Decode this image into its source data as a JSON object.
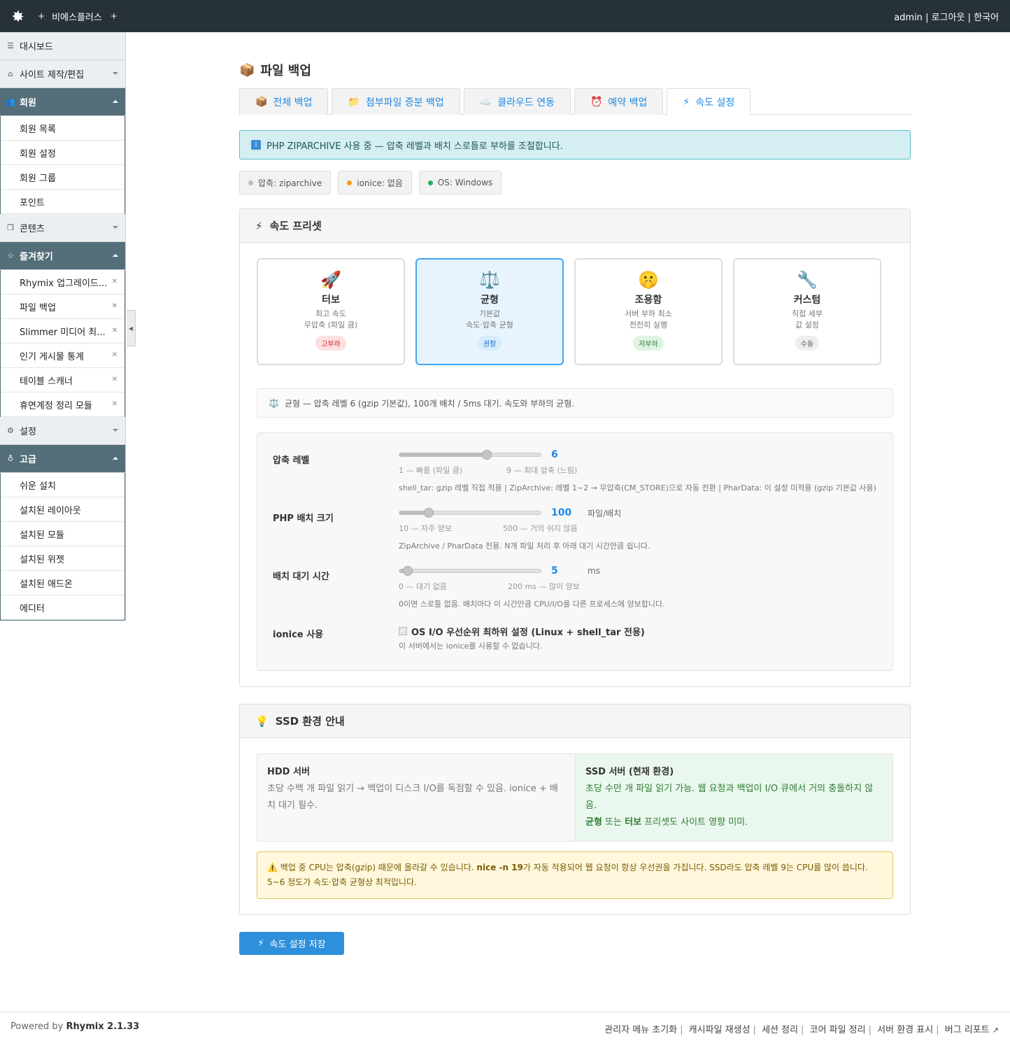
{
  "topbar": {
    "brand": "비에스플러스",
    "plus": "+",
    "user": "admin",
    "sep": "|",
    "logout": "로그아웃",
    "lang": "한국어"
  },
  "sidebar": {
    "dashboard": "대시보드",
    "site_edit": "사이트 제작/편집",
    "member": {
      "label": "회원",
      "items": [
        "회원 목록",
        "회원 설정",
        "회원 그룹",
        "포인트"
      ]
    },
    "content": "콘텐츠",
    "favorites": {
      "label": "즐겨찾기",
      "items": [
        "Rhymix 업그레이드...",
        "파일 백업",
        "Slimmer 미디어 최...",
        "인기 게시물 통계",
        "테이블 스캐너",
        "휴면계정 정리 모듈"
      ]
    },
    "settings": "설정",
    "advanced": {
      "label": "고급",
      "items": [
        "쉬운 설치",
        "설치된 레이아웃",
        "설치된 모듈",
        "설치된 위젯",
        "설치된 애드온",
        "에디터"
      ]
    }
  },
  "page": {
    "title": "파일 백업",
    "title_icon": "📦"
  },
  "tabs": [
    {
      "icon": "📦",
      "label": "전체 백업"
    },
    {
      "icon": "📁",
      "label": "첨부파일 증분 백업"
    },
    {
      "icon": "☁️",
      "label": "클라우드 연동"
    },
    {
      "icon": "⏰",
      "label": "예약 백업"
    },
    {
      "icon": "⚡",
      "label": "속도 설정"
    }
  ],
  "info": {
    "icon": "i",
    "text": "PHP ZIPARCHIVE 사용 중 — 압축 레벨과 배치 스로틀로 부하를 조절합니다."
  },
  "chips": [
    {
      "label": "압축: ziparchive",
      "color": "#bdbdbd"
    },
    {
      "label": "ionice: 없음",
      "color": "#f39c12"
    },
    {
      "label": "OS: Windows",
      "color": "#27ae60"
    }
  ],
  "preset_panel": {
    "title": "속도 프리셋",
    "icon": "⚡",
    "presets": [
      {
        "emoji": "🚀",
        "name": "터보",
        "desc1": "최고 속도",
        "desc2": "무압축 (파일 큼)",
        "badge": "고부하",
        "badge_bg": "#fde0e0",
        "badge_fg": "#c62828"
      },
      {
        "emoji": "⚖️",
        "name": "균형",
        "desc1": "기본값",
        "desc2": "속도·압축 균형",
        "badge": "권장",
        "badge_bg": "#d6ebfb",
        "badge_fg": "#1565c0"
      },
      {
        "emoji": "🤫",
        "name": "조용함",
        "desc1": "서버 부하 최소",
        "desc2": "천천히 실행",
        "badge": "저부하",
        "badge_bg": "#dff3e3",
        "badge_fg": "#2e7d32"
      },
      {
        "emoji": "🔧",
        "name": "커스텀",
        "desc1": "직접 세부",
        "desc2": "값 설정",
        "badge": "수동",
        "badge_bg": "#eeeeee",
        "badge_fg": "#555555"
      }
    ],
    "desc_icon": "⚖️",
    "desc": "균형 — 압축 레벨 6 (gzip 기본값), 100개 배치 / 5ms 대기. 속도와 부하의 균형.",
    "compression": {
      "label": "압축 레벨",
      "value": "6",
      "min": 1,
      "max": 9,
      "num": 6,
      "tick_min": "1 — 빠름 (파일 큼)",
      "tick_max": "9 — 최대 압축 (느림)",
      "note": "shell_tar: gzip 레벨 직접 적용 | ZipArchive: 레벨 1~2 → 무압축(CM_STORE)으로 자동 전환 | PharData: 이 설정 미적용 (gzip 기본값 사용)"
    },
    "batch": {
      "label": "PHP 배치 크기",
      "value": "100",
      "unit": "파일/배치",
      "min": 10,
      "max": 500,
      "num": 100,
      "tick_min": "10 — 자주 양보",
      "tick_max": "500 — 거의 쉬지 않음",
      "note": "ZipArchive / PharData 전용. N개 파일 처리 후 아래 대기 시간만큼 쉽니다."
    },
    "wait": {
      "label": "배치 대기 시간",
      "value": "5",
      "unit": "ms",
      "min": 0,
      "max": 200,
      "num": 5,
      "tick_min": "0 — 대기 없음",
      "tick_max": "200 ms — 많이 양보",
      "note": "0이면 스로틀 없음. 배치마다 이 시간만큼 CPU/I/O를 다른 프로세스에 양보합니다."
    },
    "ionice": {
      "label": "ionice 사용",
      "check_label": "OS I/O 우선순위 최하위 설정 (Linux + shell_tar 전용)",
      "note": "이 서버에서는 ionice를 사용할 수 없습니다."
    }
  },
  "ssd_panel": {
    "title": "SSD 환경 안내",
    "icon": "💡",
    "hdd_title": "HDD 서버",
    "hdd_text": "초당 수백 개 파일 읽기 → 백업이 디스크 I/O를 독점할 수 있음. ionice + 배치 대기 필수.",
    "ssd_title": "SSD 서버 (현재 환경)",
    "ssd_text": "초당 수만 개 파일 읽기 가능. 웹 요청과 백업이 I/O 큐에서 거의 충돌하지 않음.",
    "ssd_b1": "균형",
    "ssd_mid": " 또는 ",
    "ssd_b2": "터보",
    "ssd_tail": " 프리셋도 사이트 영향 미미.",
    "warn_icon": "⚠️",
    "warn_a": "백업 중 CPU는 압축(gzip) 때문에 올라갈 수 있습니다. ",
    "warn_b": "nice -n 19",
    "warn_c": "가 자동 적용되어 웹 요청이 항상 우선권을 가집니다. SSD라도 압축 레벨 9는 CPU를 많이 씁니다. 5~6 정도가 속도·압축 균형상 최적입니다."
  },
  "save": {
    "icon": "⚡",
    "label": "속도 설정 저장"
  },
  "footer": {
    "powered": "Powered by",
    "product": "Rhymix 2.1.33",
    "links": [
      "관리자 메뉴 초기화",
      "캐시파일 재생성",
      "세션 정리",
      "코어 파일 정리",
      "서버 환경 표시",
      "버그 리포트"
    ]
  }
}
